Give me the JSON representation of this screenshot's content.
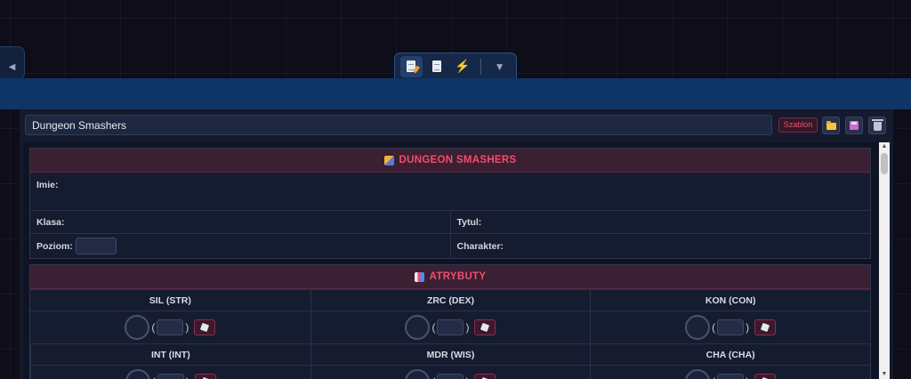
{
  "toolbar": {
    "buttons": [
      {
        "name": "edit-sheet-icon",
        "active": true
      },
      {
        "name": "document-icon",
        "active": false
      },
      {
        "name": "lightning-icon",
        "active": false
      },
      {
        "name": "collapse-icon",
        "active": false
      }
    ]
  },
  "side_tab": {
    "glyph": "◀"
  },
  "header": {
    "character_name": "Dungeon Smashers",
    "template_button": "Szablon"
  },
  "sheet": {
    "title_section": {
      "title": "DUNGEON SMASHERS",
      "fields": {
        "name_label": "Imie:",
        "class_label": "Klasa:",
        "title_label": "Tytul:",
        "level_label": "Poziom:",
        "character_label": "Charakter:"
      }
    },
    "attributes_section": {
      "title": "ATRYBUTY",
      "attributes": [
        {
          "label": "SIL (STR)"
        },
        {
          "label": "ZRC (DEX)"
        },
        {
          "label": "KON (CON)"
        },
        {
          "label": "INT (INT)"
        },
        {
          "label": "MDR (WIS)"
        },
        {
          "label": "CHA (CHA)"
        }
      ]
    }
  },
  "colors": {
    "accent": "#ef4f6e",
    "band": "#0f3566",
    "background": "#0e0d18"
  }
}
